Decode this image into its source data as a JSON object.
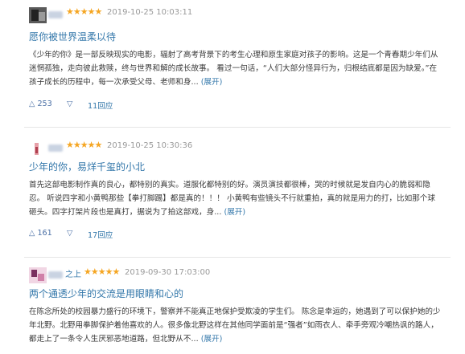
{
  "reviews": [
    {
      "username_suffix": "",
      "stars": "★★★★★",
      "time": "2019-10-25 10:03:11",
      "title": "愿你被世界温柔以待",
      "body": "《少年的你》是一部反映现实的电影，辐射了高考背景下的考生心理和原生家庭对孩子的影响。这是一个青春期少年们从迷惘孤独，走向彼此救赎，终与世界和解的成长故事。 看过一句话，“人们大部分怪异行为，归根结底都是因为缺爱。”在孩子成长的历程中，每一次承受父母、老师和身...",
      "expand": "(展开)",
      "up_count": "253",
      "replies": "11回应"
    },
    {
      "username_suffix": "",
      "stars": "★★★★★",
      "time": "2019-10-25 10:30:36",
      "title": "少年的你，易烊千玺的小北",
      "body": "首先这部电影制作真的良心，都特别的真实。道服化都特别的好。演员演技都很棒，哭的时候就是发自内心的脆弱和隐忍。 听说四字和小黄鸭那些【拳打脚踢】都是真的！！！ 小黄鸭有些镜头不行就重拍，真的就是用力的打，比如那个球砸头。四字打架片段也是真打，据说为了拍这部戏，身...",
      "expand": "(展开)",
      "up_count": "161",
      "replies": "17回应"
    },
    {
      "username_suffix": "之上",
      "stars": "★★★★★",
      "time": "2019-09-30 17:03:00",
      "title": "两个通透少年的交流是用眼睛和心的",
      "body": "在陈念所处的校园暴力盛行的环境下，警察并不能真正地保护受欺凌的学生们。 陈念是幸运的，她遇到了可以保护她的少年北野。北野用拳脚保护着他喜欢的人。很多像北野这样在其他同学面前是“强者”如雨衣人、牵手旁观冷嘲热讽的路人，都走上了一条令人生厌邪恶地道路，但北野从不...",
      "expand": "(展开)"
    }
  ],
  "vote_up_icon": "△",
  "vote_down_icon": "▽"
}
